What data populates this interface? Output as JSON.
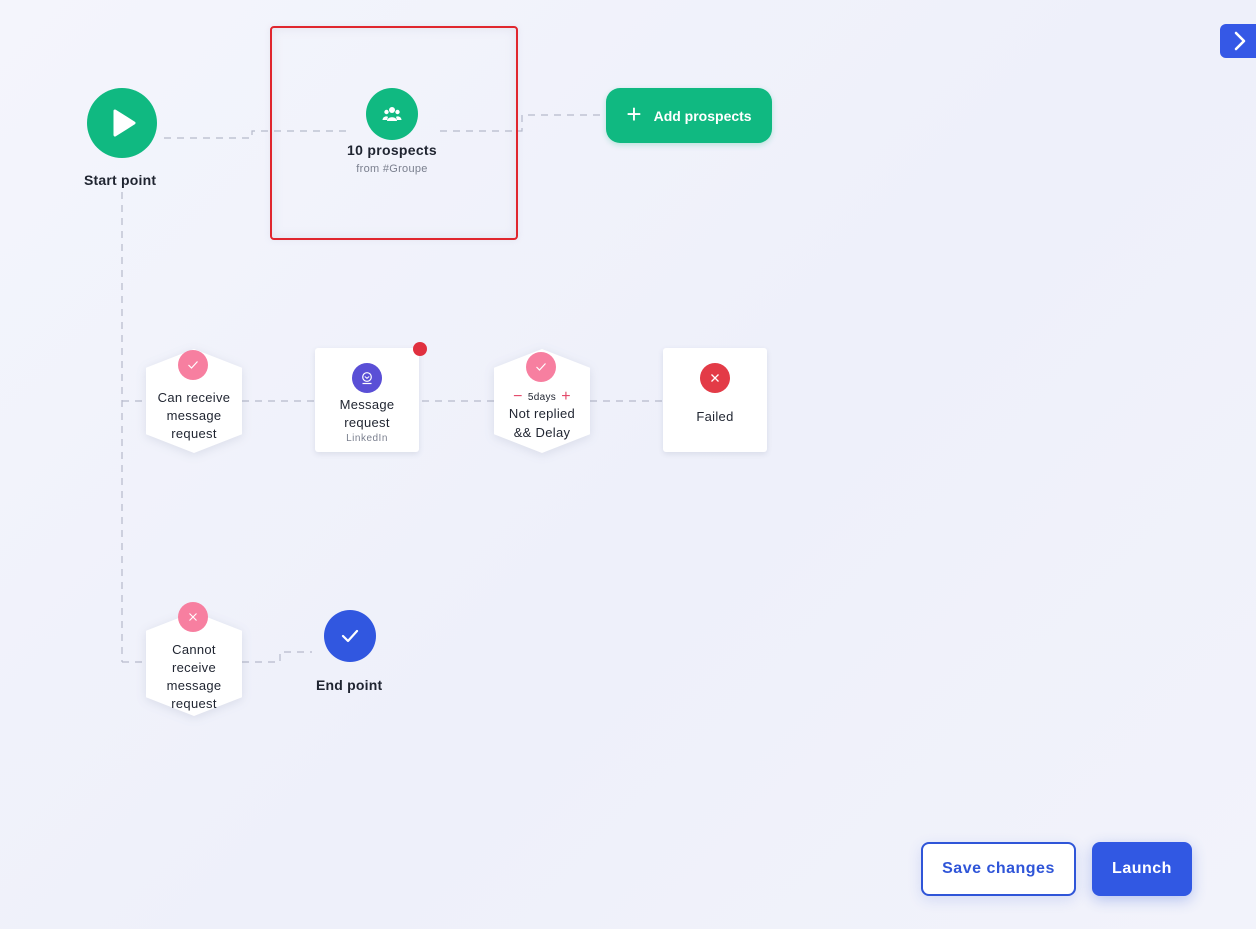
{
  "workflow": {
    "start": {
      "label": "Start point",
      "icon": "play-icon"
    },
    "prospects": {
      "title": "10 prospects",
      "subtitle": "from #Groupe",
      "icon": "users-icon"
    },
    "add_prospects": {
      "label": "Add prospects",
      "icon": "plus-icon"
    },
    "branch_yes": {
      "condition": {
        "line1": "Can receive",
        "line2": "message",
        "line3": "request",
        "icon": "check-icon"
      },
      "message": {
        "line1": "Message",
        "line2": "request",
        "platform": "LinkedIn",
        "icon": "message-icon",
        "notification": true
      },
      "delay": {
        "value": "5days",
        "line1": "Not replied",
        "line2": "&& Delay",
        "minus": "−",
        "plus": "+",
        "icon": "check-icon"
      },
      "failed": {
        "label": "Failed",
        "icon": "close-icon"
      }
    },
    "branch_no": {
      "condition": {
        "line1": "Cannot",
        "line2": "receive",
        "line3": "message",
        "line4": "request",
        "icon": "close-icon"
      },
      "end": {
        "label": "End point",
        "icon": "check-icon"
      }
    }
  },
  "footer": {
    "save_label": "Save changes",
    "launch_label": "Launch"
  },
  "panel_toggle": {
    "icon": "chevron-right-icon"
  },
  "colors": {
    "green": "#10b981",
    "blue": "#3158e3",
    "pink": "#f77fa0",
    "red": "#e33b47",
    "purple": "#5a4fd6",
    "selection": "#e0262e"
  }
}
